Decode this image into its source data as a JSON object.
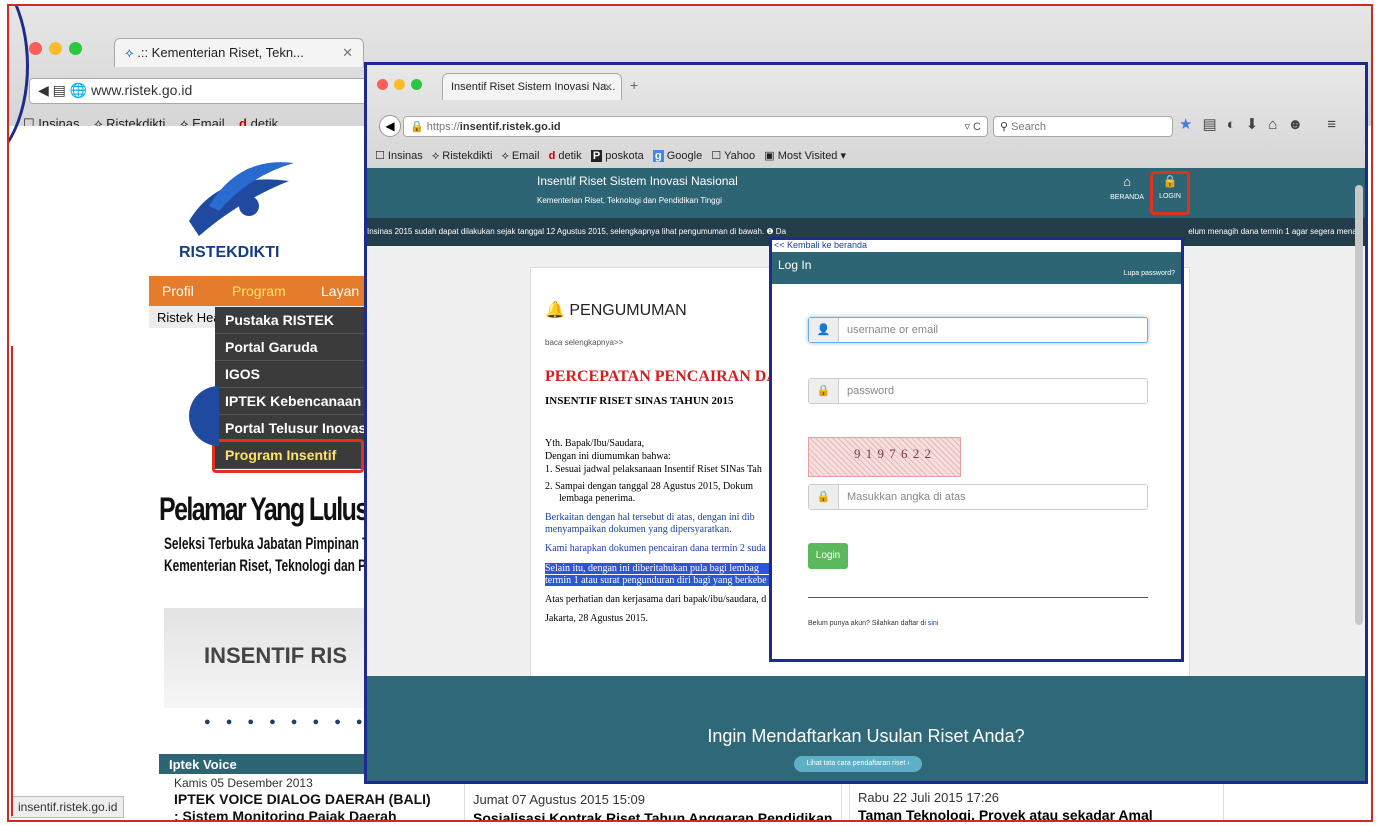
{
  "back_window": {
    "tab_title": ".:: Kementerian Riset, Tekn...",
    "url": "www.ristek.go.id",
    "bookmarks": [
      "Insinas",
      "Ristekdikti",
      "Email",
      "detik"
    ],
    "logo_text": "RISTEKDIKTI",
    "nav": [
      "Profil",
      "Program",
      "Layan"
    ],
    "ribbon": "Ristek Hea",
    "menu": [
      "Pustaka RISTEK",
      "Portal Garuda",
      "IGOS",
      "IPTEK Kebencanaan",
      "Portal Telusur Inovas",
      "Program Insentif"
    ],
    "headline": "Pelamar Yang Lulus Seleksi A",
    "sub1": "Seleksi Terbuka Jabatan Pimpinan Tinggi Pr",
    "sub2": "Kementerian Riset, Teknologi dan Per",
    "banner": "INSENTIF RIS",
    "iptek_header": "Iptek Voice",
    "iptek_date": "Kamis 05 Desember 2013",
    "iptek_title1": "IPTEK VOICE DIALOG DAERAH (BALI)",
    "iptek_title2": ": Sistem Monitoring Pajak Daerah",
    "news2_date": "Jumat 07 Agustus 2015 15:09",
    "news2_title": "Sosialisasi Kontrak Riset Tahun Anggaran Pendidikan",
    "news3_date": "Rabu 22 Juli 2015 17:26",
    "news3_title": "Taman Teknologi, Proyek atau sekadar Amal",
    "status_url": "insentif.ristek.go.id"
  },
  "front_window": {
    "tab_title": "Insentif Riset Sistem Inovasi Na...",
    "url_prefix": "https://",
    "url_domain": "insentif.ristek.go.id",
    "search_placeholder": "Search",
    "bookmarks": [
      "Insinas",
      "Ristekdikti",
      "Email",
      "detik",
      "poskota",
      "Google",
      "Yahoo",
      "Most Visited"
    ],
    "site_title": "Insentif Riset Sistem Inovasi Nasional",
    "site_subtitle": "Kementerian Riset, Teknologi dan Pendidikan Tinggi",
    "nav_home": "BERANDA",
    "nav_login": "LOGIN",
    "ticker_left": "Insinas 2015 sudah dapat dilakukan sejak tanggal 12 Agustus 2015, selengkapnya lihat pengumuman di bawah.   ❶ Da",
    "ticker_right": "elum menagih dana termin 1 agar segera menagi",
    "announcement_heading": "PENGUMUMAN",
    "read_more": "baca selengkapnya>>",
    "ann_title": "PERCEPATAN PENCAIRAN DANA",
    "ann_subtitle": "INSENTIF RISET SINAS TAHUN 2015",
    "ann_greeting": "Yth. Bapak/Ibu/Saudara,",
    "ann_intro": "Dengan ini diumumkan bahwa:",
    "ann_item1": "1.  Sesuai jadwal pelaksanaan Insentif Riset SINas Tah",
    "ann_item2a": "2.  Sampai dengan tanggal 28 Agustus 2015, Dokum",
    "ann_item2b": "lembaga penerima.",
    "ann_blue1a": "Berkaitan dengan hal tersebut di atas, dengan ini dib",
    "ann_blue1b": "menyampaikan dokumen yang dipersyaratkan.",
    "ann_blue2": "Kami harapkan dokumen pencairan dana termin 2 suda",
    "ann_hl1": "Selain itu, dengan ini diberitahukan pula bagi lembag",
    "ann_hl2": "termin 1 atau surat pengunduran diri bagi yang berkebe",
    "ann_closing": "Atas perhatian dan kerjasama dari bapak/ibu/saudara, d",
    "ann_date": "Jakarta, 28 Agustus 2015.",
    "footer_heading": "Ingin Mendaftarkan Usulan Riset Anda?",
    "footer_button": "Lihat tata cara pendaftaran riset ›"
  },
  "login": {
    "back_link": "<< Kembali ke beranda",
    "title": "Log In",
    "forgot": "Lupa password?",
    "username_placeholder": "username or email",
    "password_placeholder": "password",
    "captcha_text": "9 1 9 7 6 2 2",
    "captcha_placeholder": "Masukkan angka di atas",
    "button": "Login",
    "register_prompt": "Belum punya akun? Silahkan daftar di ",
    "register_link": "sini"
  },
  "colors": {
    "teal": "#2e6575",
    "login_green": "#5cb85c",
    "highlight": "#e0301e",
    "callout_blue": "#1c2c8c"
  }
}
